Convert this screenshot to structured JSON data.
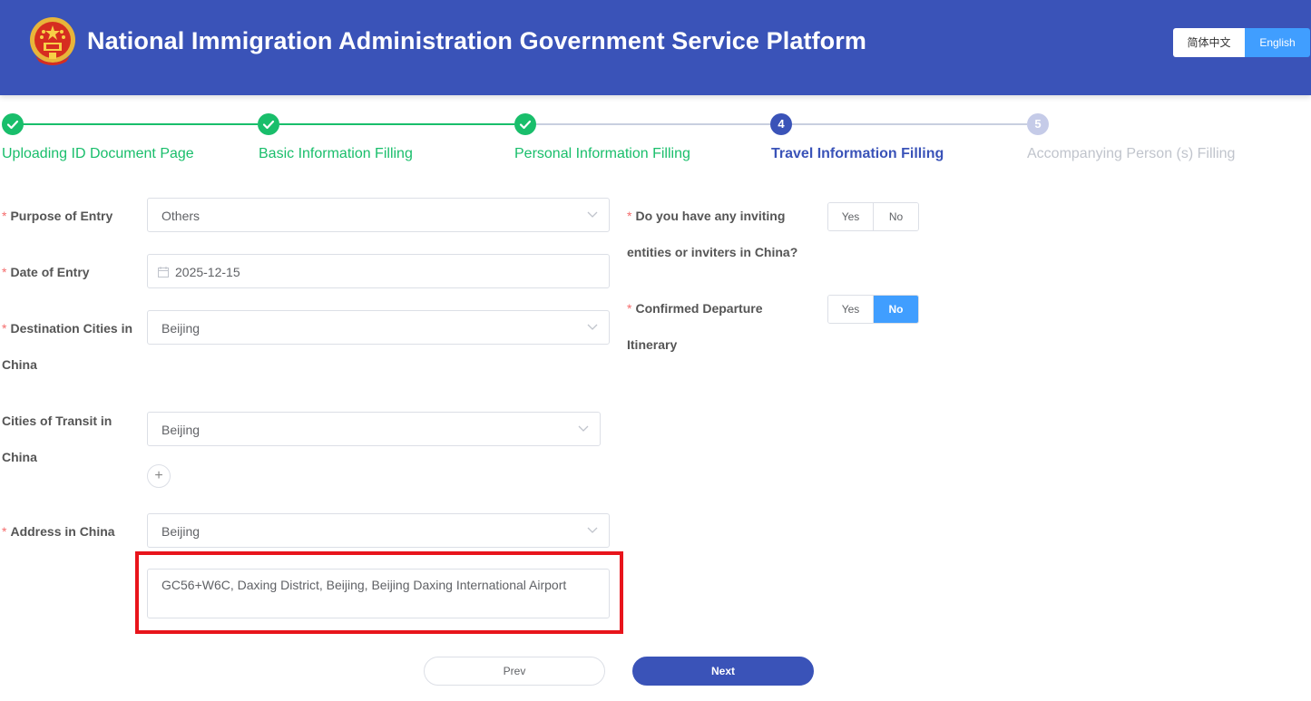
{
  "header": {
    "title": "National Immigration Administration Government Service Platform",
    "lang_zh": "简体中文",
    "lang_en": "English",
    "active_lang": "English"
  },
  "colors": {
    "header_bg": "#3a53b8",
    "step_done": "#19be6b",
    "step_active": "#3a53b8",
    "step_pending": "#c0c4cc",
    "accent": "#409eff",
    "required": "#f56c6c",
    "highlight": "#e8141b"
  },
  "steps": [
    {
      "number": "1",
      "label": "Uploading ID Document Page",
      "status": "done",
      "icon": "check-icon"
    },
    {
      "number": "2",
      "label": "Basic Information Filling",
      "status": "done",
      "icon": "check-icon"
    },
    {
      "number": "3",
      "label": "Personal Information Filling",
      "status": "done",
      "icon": "check-icon"
    },
    {
      "number": "4",
      "label": "Travel Information Filling",
      "status": "active"
    },
    {
      "number": "5",
      "label": "Accompanying Person (s) Filling",
      "status": "pending"
    }
  ],
  "form": {
    "required_mark": "*",
    "purpose": {
      "label": "Purpose of Entry",
      "value": "Others"
    },
    "date": {
      "label": "Date of Entry",
      "value": "2025-12-15"
    },
    "destination": {
      "label_line1": "Destination Cities in",
      "label_line2": "China",
      "value": "Beijing"
    },
    "transit": {
      "label_line1": "Cities of Transit in",
      "label_line2": "China",
      "value": "Beijing",
      "add_label": "+"
    },
    "address": {
      "label": "Address in China",
      "value": "Beijing",
      "detail": "GC56+W6C, Daxing District, Beijing, Beijing Daxing International Airport"
    },
    "inviting": {
      "label_line1": "Do you have any inviting",
      "label_line2": "entities or inviters in China?",
      "yes": "Yes",
      "no": "No",
      "selected": "none"
    },
    "departure": {
      "label_line1": "Confirmed Departure",
      "label_line2": "Itinerary",
      "yes": "Yes",
      "no": "No",
      "selected": "No"
    }
  },
  "buttons": {
    "prev": "Prev",
    "next": "Next"
  }
}
